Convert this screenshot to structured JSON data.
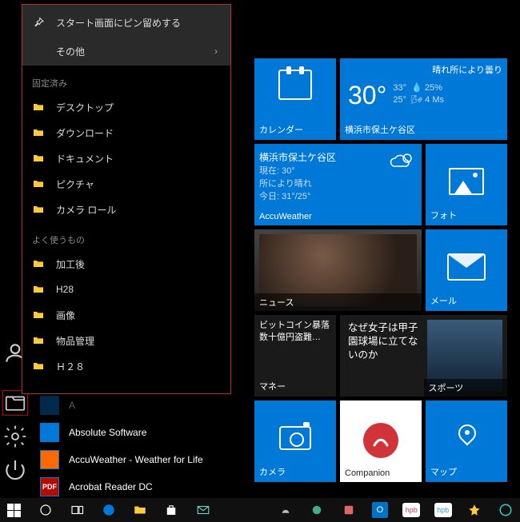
{
  "context_menu": {
    "pin_to_start": "スタート画面にピン留めする",
    "other": "その他",
    "pinned_header": "固定済み",
    "pinned": [
      "デスクトップ",
      "ダウンロード",
      "ドキュメント",
      "ピクチャ",
      "カメラ ロール"
    ],
    "frequent_header": "よく使うもの",
    "frequent": [
      "加工後",
      "H28",
      "画像",
      "物品管理",
      "Ｈ２８"
    ]
  },
  "apps_list": {
    "partial": "A",
    "items": [
      "Absolute Software",
      "AccuWeather - Weather for Life",
      "Acrobat Reader DC"
    ]
  },
  "tiles": {
    "calendar": {
      "label": "カレンダー"
    },
    "weather": {
      "headline": "晴れ所により曇り",
      "temp": "30°",
      "high": "33°",
      "low": "25°",
      "humidity_pct": "25%",
      "wind": "4 Ms",
      "location": "横浜市保土ケ谷区"
    },
    "accuweather": {
      "label": "AccuWeather",
      "location": "横浜市保土ケ谷区",
      "current": "現在: 30°",
      "cond": "所により晴れ",
      "tomorrow": "今日: 31°/25°"
    },
    "photos": {
      "label": "フォト"
    },
    "news": {
      "label": "ニュース"
    },
    "mail": {
      "label": "メール"
    },
    "money_headline1": "ビットコイン暴落 数十億円盗難…",
    "money_label": "マネー",
    "sports_headline": "なぜ女子は甲子園球場に立てないのか",
    "sports_label": "スポーツ",
    "camera": {
      "label": "カメラ"
    },
    "companion": {
      "label": "Companion"
    },
    "maps": {
      "label": "マップ"
    }
  },
  "rail": {
    "explorer": "エクスプローラー",
    "settings": "設定",
    "power": "電源"
  },
  "taskbar": {
    "items": [
      "start",
      "cortana",
      "task-view",
      "edge",
      "file-explorer",
      "store",
      "mail",
      "generic1",
      "generic2",
      "generic3",
      "outlook",
      "hpb1",
      "hpb2",
      "generic4",
      "generic5"
    ]
  }
}
